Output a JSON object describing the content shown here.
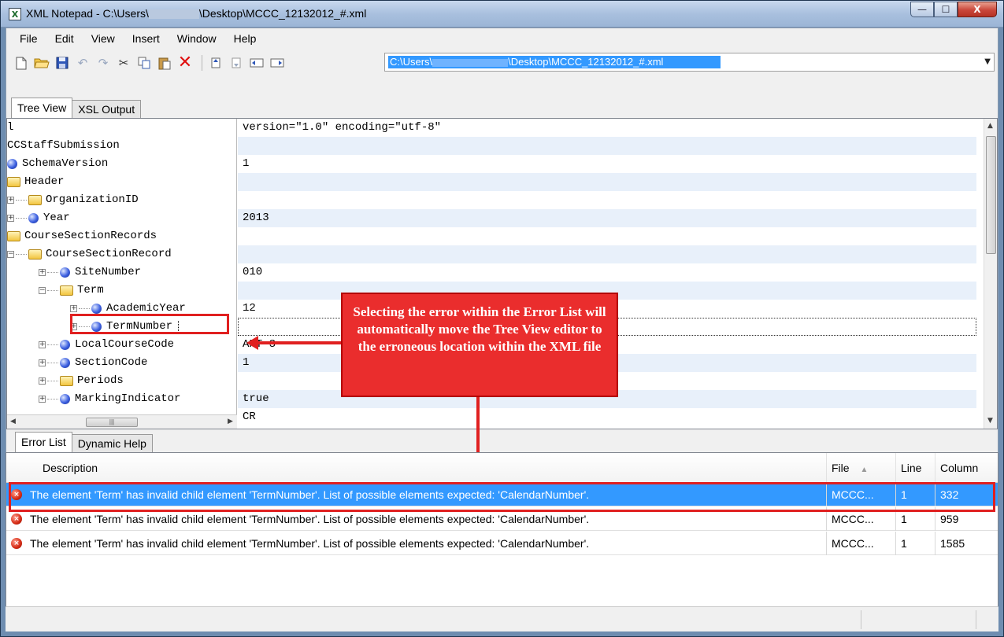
{
  "window": {
    "title_prefix": "XML Notepad - C:\\Users\\",
    "title_suffix": "\\Desktop\\MCCC_12132012_#.xml",
    "app_icon": "X",
    "controls": {
      "minimize": "—",
      "maximize": "☐",
      "close": "X"
    }
  },
  "menu": [
    "File",
    "Edit",
    "View",
    "Insert",
    "Window",
    "Help"
  ],
  "toolbar": {
    "icons": [
      "new-document-icon",
      "open-folder-icon",
      "save-icon",
      "undo-icon",
      "redo-icon",
      "cut-icon",
      "copy-icon",
      "paste-icon",
      "delete-icon",
      "nudge-up-icon",
      "nudge-down-icon",
      "nudge-left-icon",
      "nudge-right-icon"
    ],
    "path_prefix": "C:\\Users\\",
    "path_suffix": "\\Desktop\\MCCC_12132012_#.xml"
  },
  "top_tabs": [
    "Tree View",
    "XSL Output"
  ],
  "tree": [
    {
      "label": "l",
      "indent": 0,
      "type": "none",
      "expander": ""
    },
    {
      "label": "CCStaffSubmission",
      "indent": 0,
      "type": "none",
      "expander": ""
    },
    {
      "label": "SchemaVersion",
      "indent": 0,
      "type": "ball",
      "expander": ""
    },
    {
      "label": "Header",
      "indent": 0,
      "type": "folder",
      "expander": ""
    },
    {
      "label": "OrganizationID",
      "indent": 1,
      "type": "folder",
      "expander": "+"
    },
    {
      "label": "Year",
      "indent": 1,
      "type": "ball",
      "expander": "+"
    },
    {
      "label": "CourseSectionRecords",
      "indent": 0,
      "type": "folder",
      "expander": ""
    },
    {
      "label": "CourseSectionRecord",
      "indent": 1,
      "type": "folder",
      "expander": "−"
    },
    {
      "label": "SiteNumber",
      "indent": 2,
      "type": "ball",
      "expander": "+"
    },
    {
      "label": "Term",
      "indent": 2,
      "type": "folder",
      "expander": "−"
    },
    {
      "label": "AcademicYear",
      "indent": 3,
      "type": "ball",
      "expander": "+"
    },
    {
      "label": "TermNumber",
      "indent": 3,
      "type": "ball",
      "expander": "+"
    },
    {
      "label": "LocalCourseCode",
      "indent": 2,
      "type": "ball",
      "expander": "+"
    },
    {
      "label": "SectionCode",
      "indent": 2,
      "type": "ball",
      "expander": "+"
    },
    {
      "label": "Periods",
      "indent": 2,
      "type": "folder",
      "expander": "+"
    },
    {
      "label": "MarkingIndicator",
      "indent": 2,
      "type": "ball",
      "expander": "+"
    }
  ],
  "values": [
    "version=\"1.0\" encoding=\"utf-8\"",
    "",
    "1",
    "",
    "",
    "2013",
    "",
    "",
    "010",
    "",
    "12",
    "",
    "ART-3",
    "1",
    "",
    "true",
    "CR"
  ],
  "callout": "Selecting the error within the Error List will automatically move the Tree View editor to the erroneous location within the XML file",
  "bottom_tabs": [
    "Error List",
    "Dynamic Help"
  ],
  "error_list": {
    "columns": [
      "Description",
      "File",
      "Line",
      "Column"
    ],
    "sort_indicator": "▲",
    "rows": [
      {
        "description": "The element 'Term' has invalid child element 'TermNumber'. List of possible elements expected: 'CalendarNumber'.",
        "file": "MCCC...",
        "line": "1",
        "column": "332",
        "selected": true
      },
      {
        "description": "The element 'Term' has invalid child element 'TermNumber'. List of possible elements expected: 'CalendarNumber'.",
        "file": "MCCC...",
        "line": "1",
        "column": "959",
        "selected": false
      },
      {
        "description": "The element 'Term' has invalid child element 'TermNumber'. List of possible elements expected: 'CalendarNumber'.",
        "file": "MCCC...",
        "line": "1",
        "column": "1585",
        "selected": false
      }
    ]
  },
  "colors": {
    "selection": "#3399ff",
    "highlight": "#e02020",
    "error_icon": "#d42a14"
  }
}
